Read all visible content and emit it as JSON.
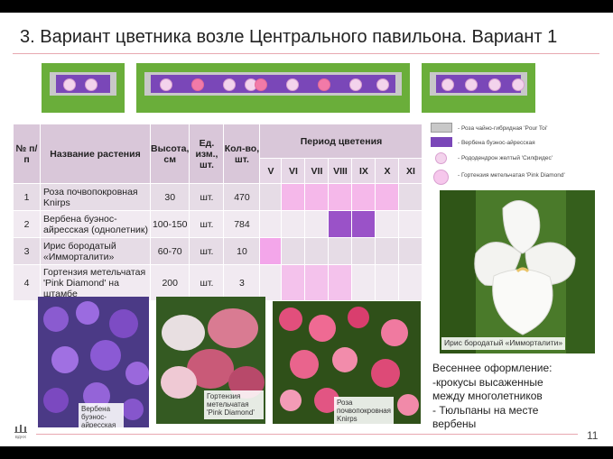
{
  "title": "3. Вариант цветника возле Центрального павильона. Вариант 1",
  "table": {
    "headers": {
      "num": "№ п/п",
      "name": "Название растения",
      "height": "Высота, см",
      "unit": "Ед. изм., шт.",
      "qty": "Кол-во, шт.",
      "period": "Период цветения"
    },
    "months": [
      "V",
      "VI",
      "VII",
      "VIII",
      "IX",
      "X",
      "XI"
    ],
    "rows": [
      {
        "num": "1",
        "name_line1": "Роза почвопокровная",
        "name_line2": "Knirps",
        "height": "30",
        "unit": "шт.",
        "qty": "470"
      },
      {
        "num": "2",
        "name_line1": "Вербена буэнос-",
        "name_line2": "айресская (однолетник)",
        "height": "100-150",
        "unit": "шт.",
        "qty": "784"
      },
      {
        "num": "3",
        "name_line1": "Ирис бородатый",
        "name_line2": "«Имморталити»",
        "height": "60-70",
        "unit": "шт.",
        "qty": "10"
      },
      {
        "num": "4",
        "name_line1": "Гортензия метельчатая",
        "name_line2": "'Pink Diamond' на штамбе",
        "height": "200",
        "unit": "шт.",
        "qty": "3"
      }
    ],
    "bloom": [
      {
        "start": 1,
        "end": 5,
        "color": "#f5b8ea"
      },
      {
        "start": 3,
        "end": 4,
        "color": "#9a52c8"
      },
      {
        "start": 0,
        "end": 0,
        "color": "#f3a6ea"
      },
      {
        "start": 1,
        "end": 3,
        "color": "#f4c2ec"
      }
    ]
  },
  "legend": [
    {
      "swatch": "#c8c8c8",
      "text": "- Роза чайно-гибридная 'Pour Toi'"
    },
    {
      "swatch": "#7a47b8",
      "text": "- Вербена буэнос-айресская"
    },
    {
      "swatch": "#f3d3ec",
      "text": "- Рододендрон желтый 'Силфидес'"
    },
    {
      "swatch": "#f3d3ec",
      "text": "- Гортензия метельчатая 'Pink Diamond'"
    }
  ],
  "photos": {
    "verbena": "Вербена буэнос-айресская",
    "hydrangea": "Гортензия метельчатая 'Pink Diamond'",
    "rose": "Роза почвопокровная Knirps",
    "iris": "Ирис бородатый «Имморталити»"
  },
  "spring": {
    "line1": "Весеннее оформление:",
    "line2": "-крокусы высаженные",
    "line3": "между многолетников",
    "line4": "- Тюльпаны на месте",
    "line5": "вербены"
  },
  "logo_text": "ВДНХ",
  "page_number": "11"
}
